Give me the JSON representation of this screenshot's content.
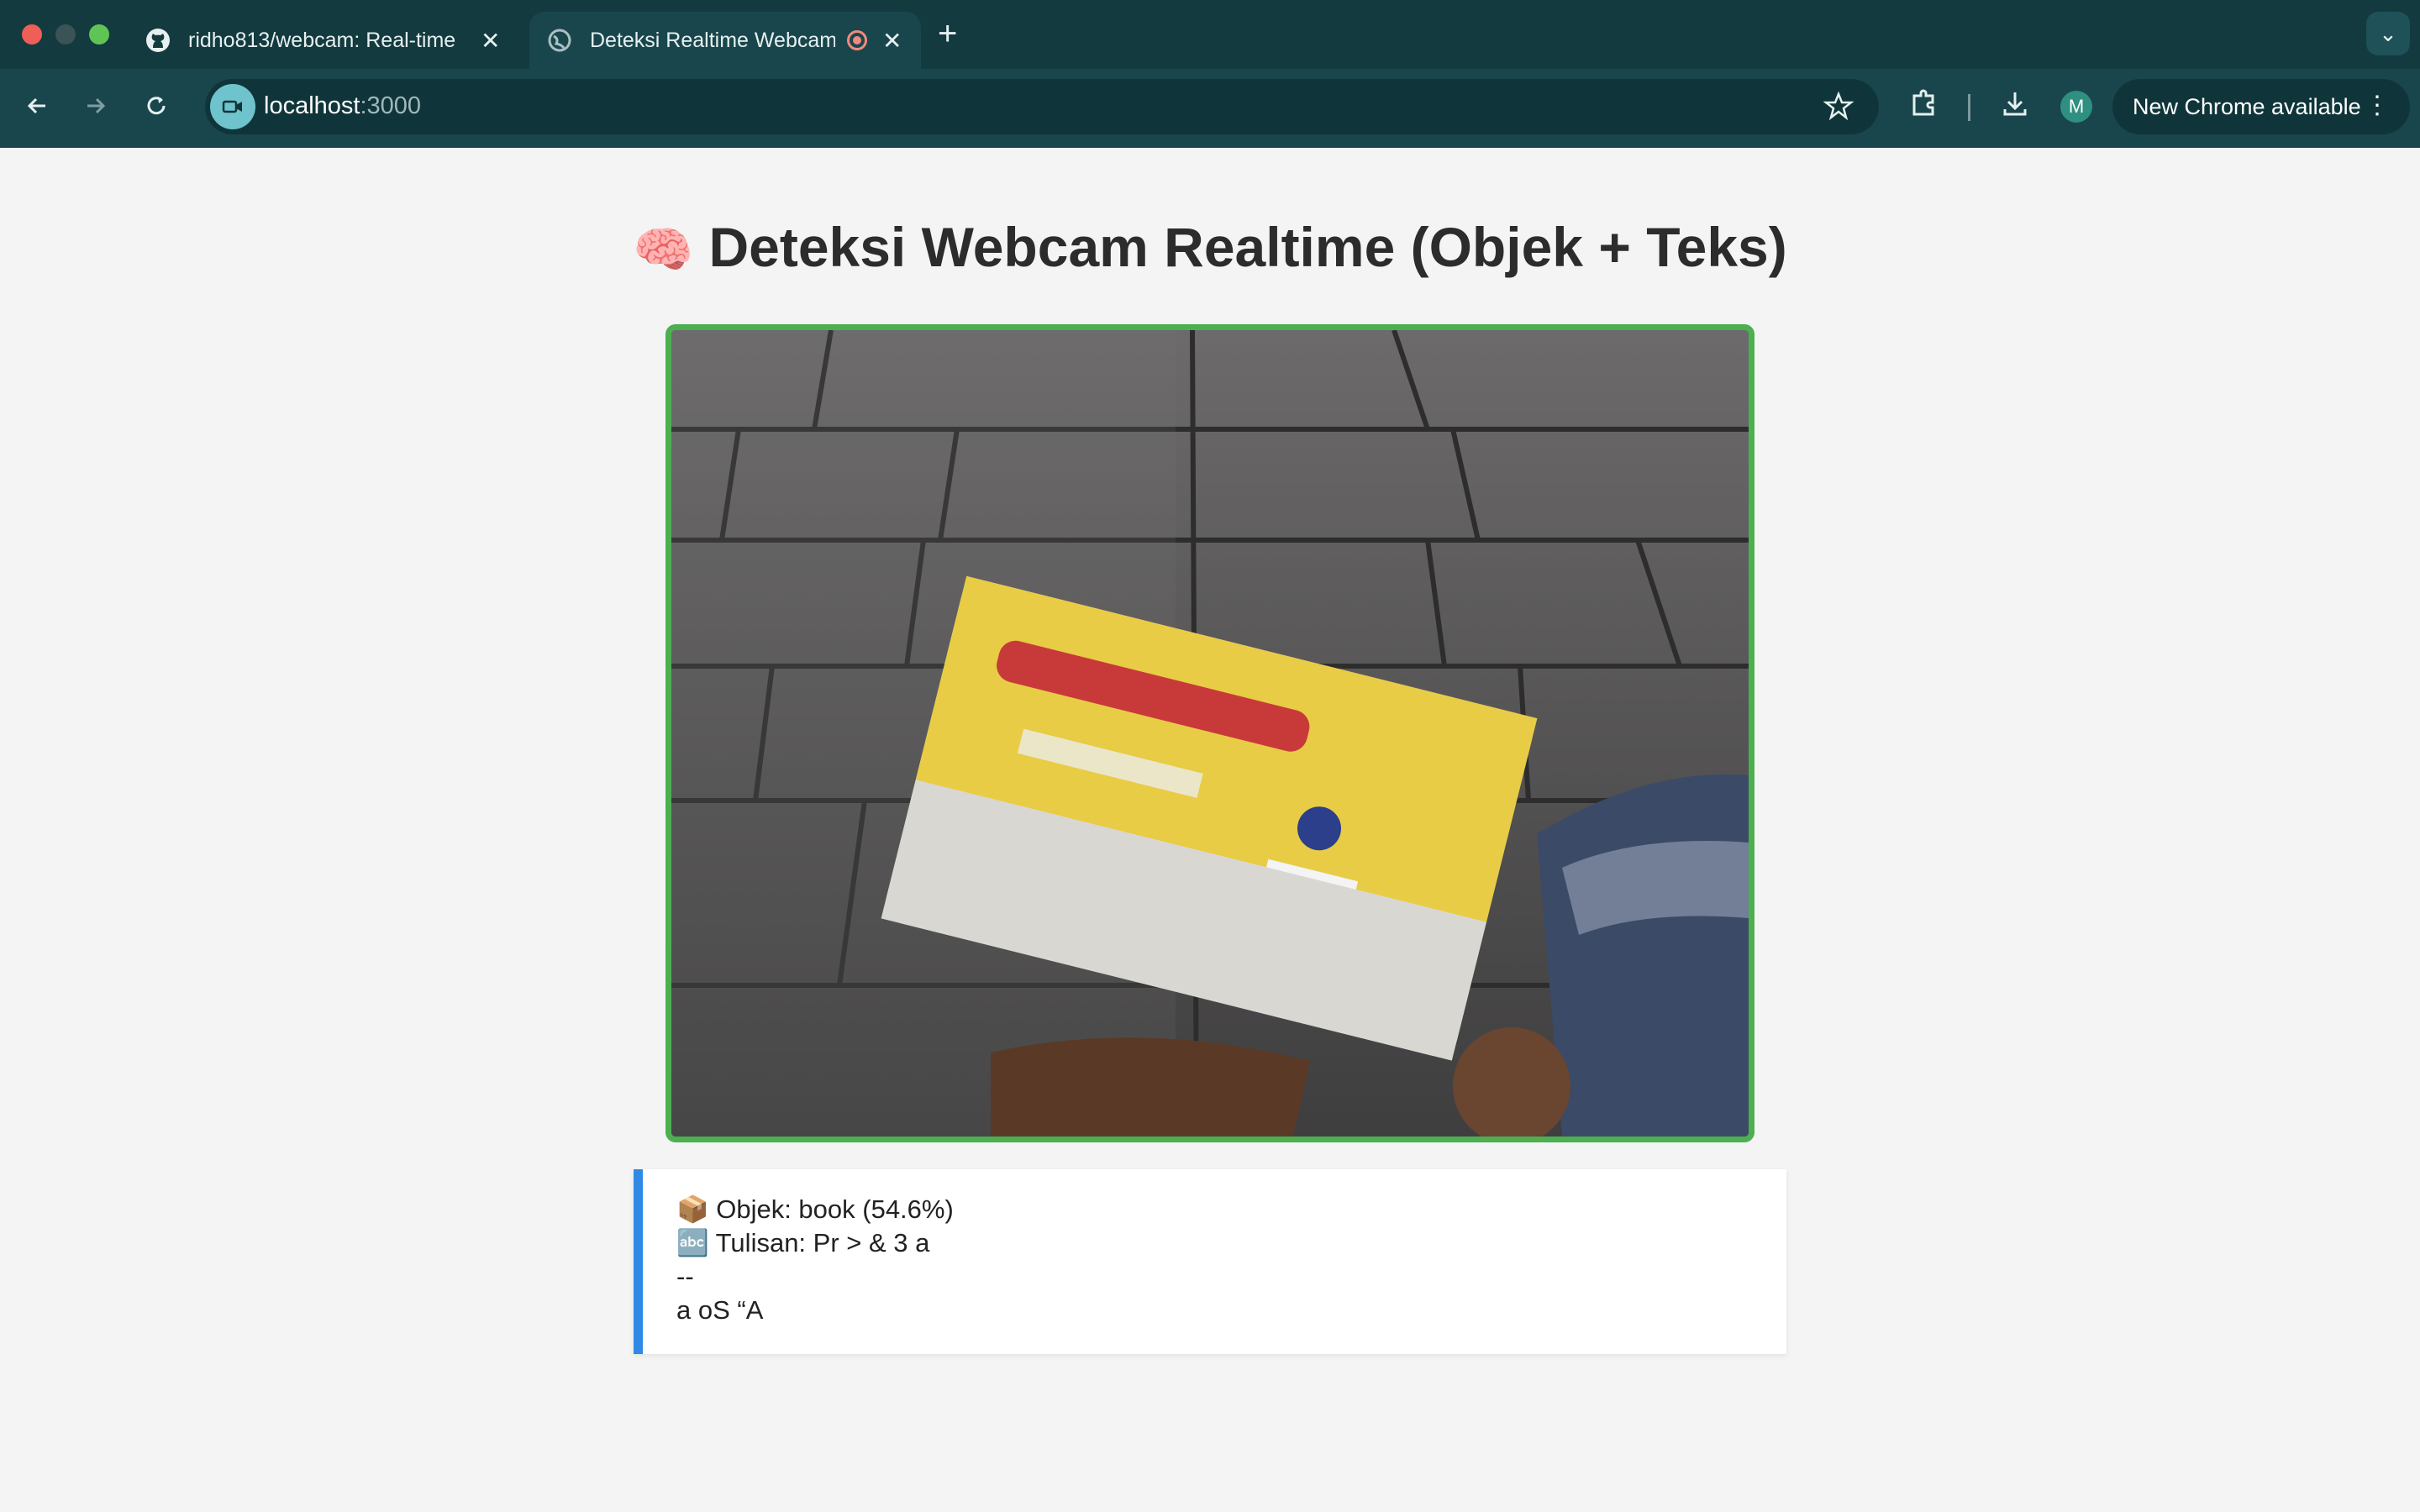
{
  "browser": {
    "tabs": [
      {
        "title": "ridho813/webcam: Real-time",
        "icon": "github-icon",
        "active": false
      },
      {
        "title": "Deteksi Realtime Webcam",
        "icon": "globe-icon",
        "active": true,
        "recording": true
      }
    ],
    "url_host": "localhost",
    "url_port": ":3000",
    "avatar_letter": "M",
    "update_label": "New Chrome available"
  },
  "page": {
    "title_emoji": "🧠",
    "title": "Deteksi Webcam Realtime (Objek + Teks)",
    "video_border_color": "#4caf50",
    "results": {
      "object_line": "📦 Objek: book (54.6%)",
      "text_line": "🔤 Tulisan: Pr > & 3 a",
      "extra_line_1": "--",
      "extra_line_2": "a oS “A",
      "accent_color": "#2f8ae5"
    }
  }
}
